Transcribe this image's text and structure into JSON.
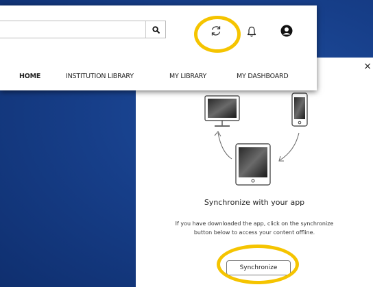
{
  "header": {
    "search": {
      "value": "",
      "placeholder": ""
    },
    "icons": [
      "search-icon",
      "sync-icon",
      "bell-icon",
      "user-account-icon"
    ]
  },
  "nav": {
    "items": [
      {
        "label": "HOME",
        "active": true
      },
      {
        "label": "INSTITUTION LIBRARY",
        "active": false
      },
      {
        "label": "MY LIBRARY",
        "active": false
      },
      {
        "label": "MY DASHBOARD",
        "active": false
      }
    ]
  },
  "modal": {
    "close_label": "×",
    "title": "Synchronize with your app",
    "description_line1": "If you have downloaded the app, click on the synchronize",
    "description_line2": "button below to access your content offline.",
    "button_label": "Synchronize"
  },
  "colors": {
    "background": "#173f8a",
    "highlight": "#f5c400",
    "panel": "#ffffff"
  }
}
